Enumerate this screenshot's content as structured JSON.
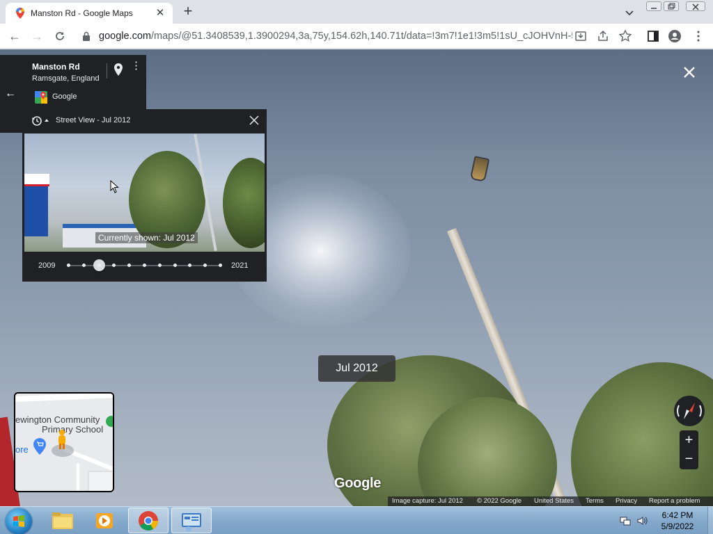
{
  "browser": {
    "tab_title": "Manston Rd - Google Maps",
    "url_host": "google.com",
    "url_path": "/maps/@51.3408539,1.3900294,3a,75y,154.62h,140.71t/data=!3m7!1e1!3m5!1sU_cJOHVnH-5ufj..."
  },
  "place": {
    "name": "Manston Rd",
    "address": "Ramsgate, England",
    "source": "Google"
  },
  "time_panel": {
    "title": "Street View - Jul 2012",
    "caption": "Currently shown: Jul 2012",
    "year_start": "2009",
    "year_end": "2021",
    "selected_index": 2,
    "point_count": 11
  },
  "date_label": "Jul 2012",
  "minimap": {
    "place_line1": "ewington Community",
    "place_line2": "Primary School",
    "store_label": "ore"
  },
  "controls": {
    "zoom_in": "+",
    "zoom_out": "−"
  },
  "logo": "Google",
  "footer": {
    "capture": "Image capture: Jul 2012",
    "copyright": "© 2022 Google",
    "region": "United States",
    "terms": "Terms",
    "privacy": "Privacy",
    "report": "Report a problem"
  },
  "taskbar": {
    "time": "6:42 PM",
    "date": "5/9/2022"
  },
  "colors": {
    "panel_bg": "#202124",
    "chrome_tabstrip": "#dee1e6",
    "taskbar": "#85a9cb"
  }
}
